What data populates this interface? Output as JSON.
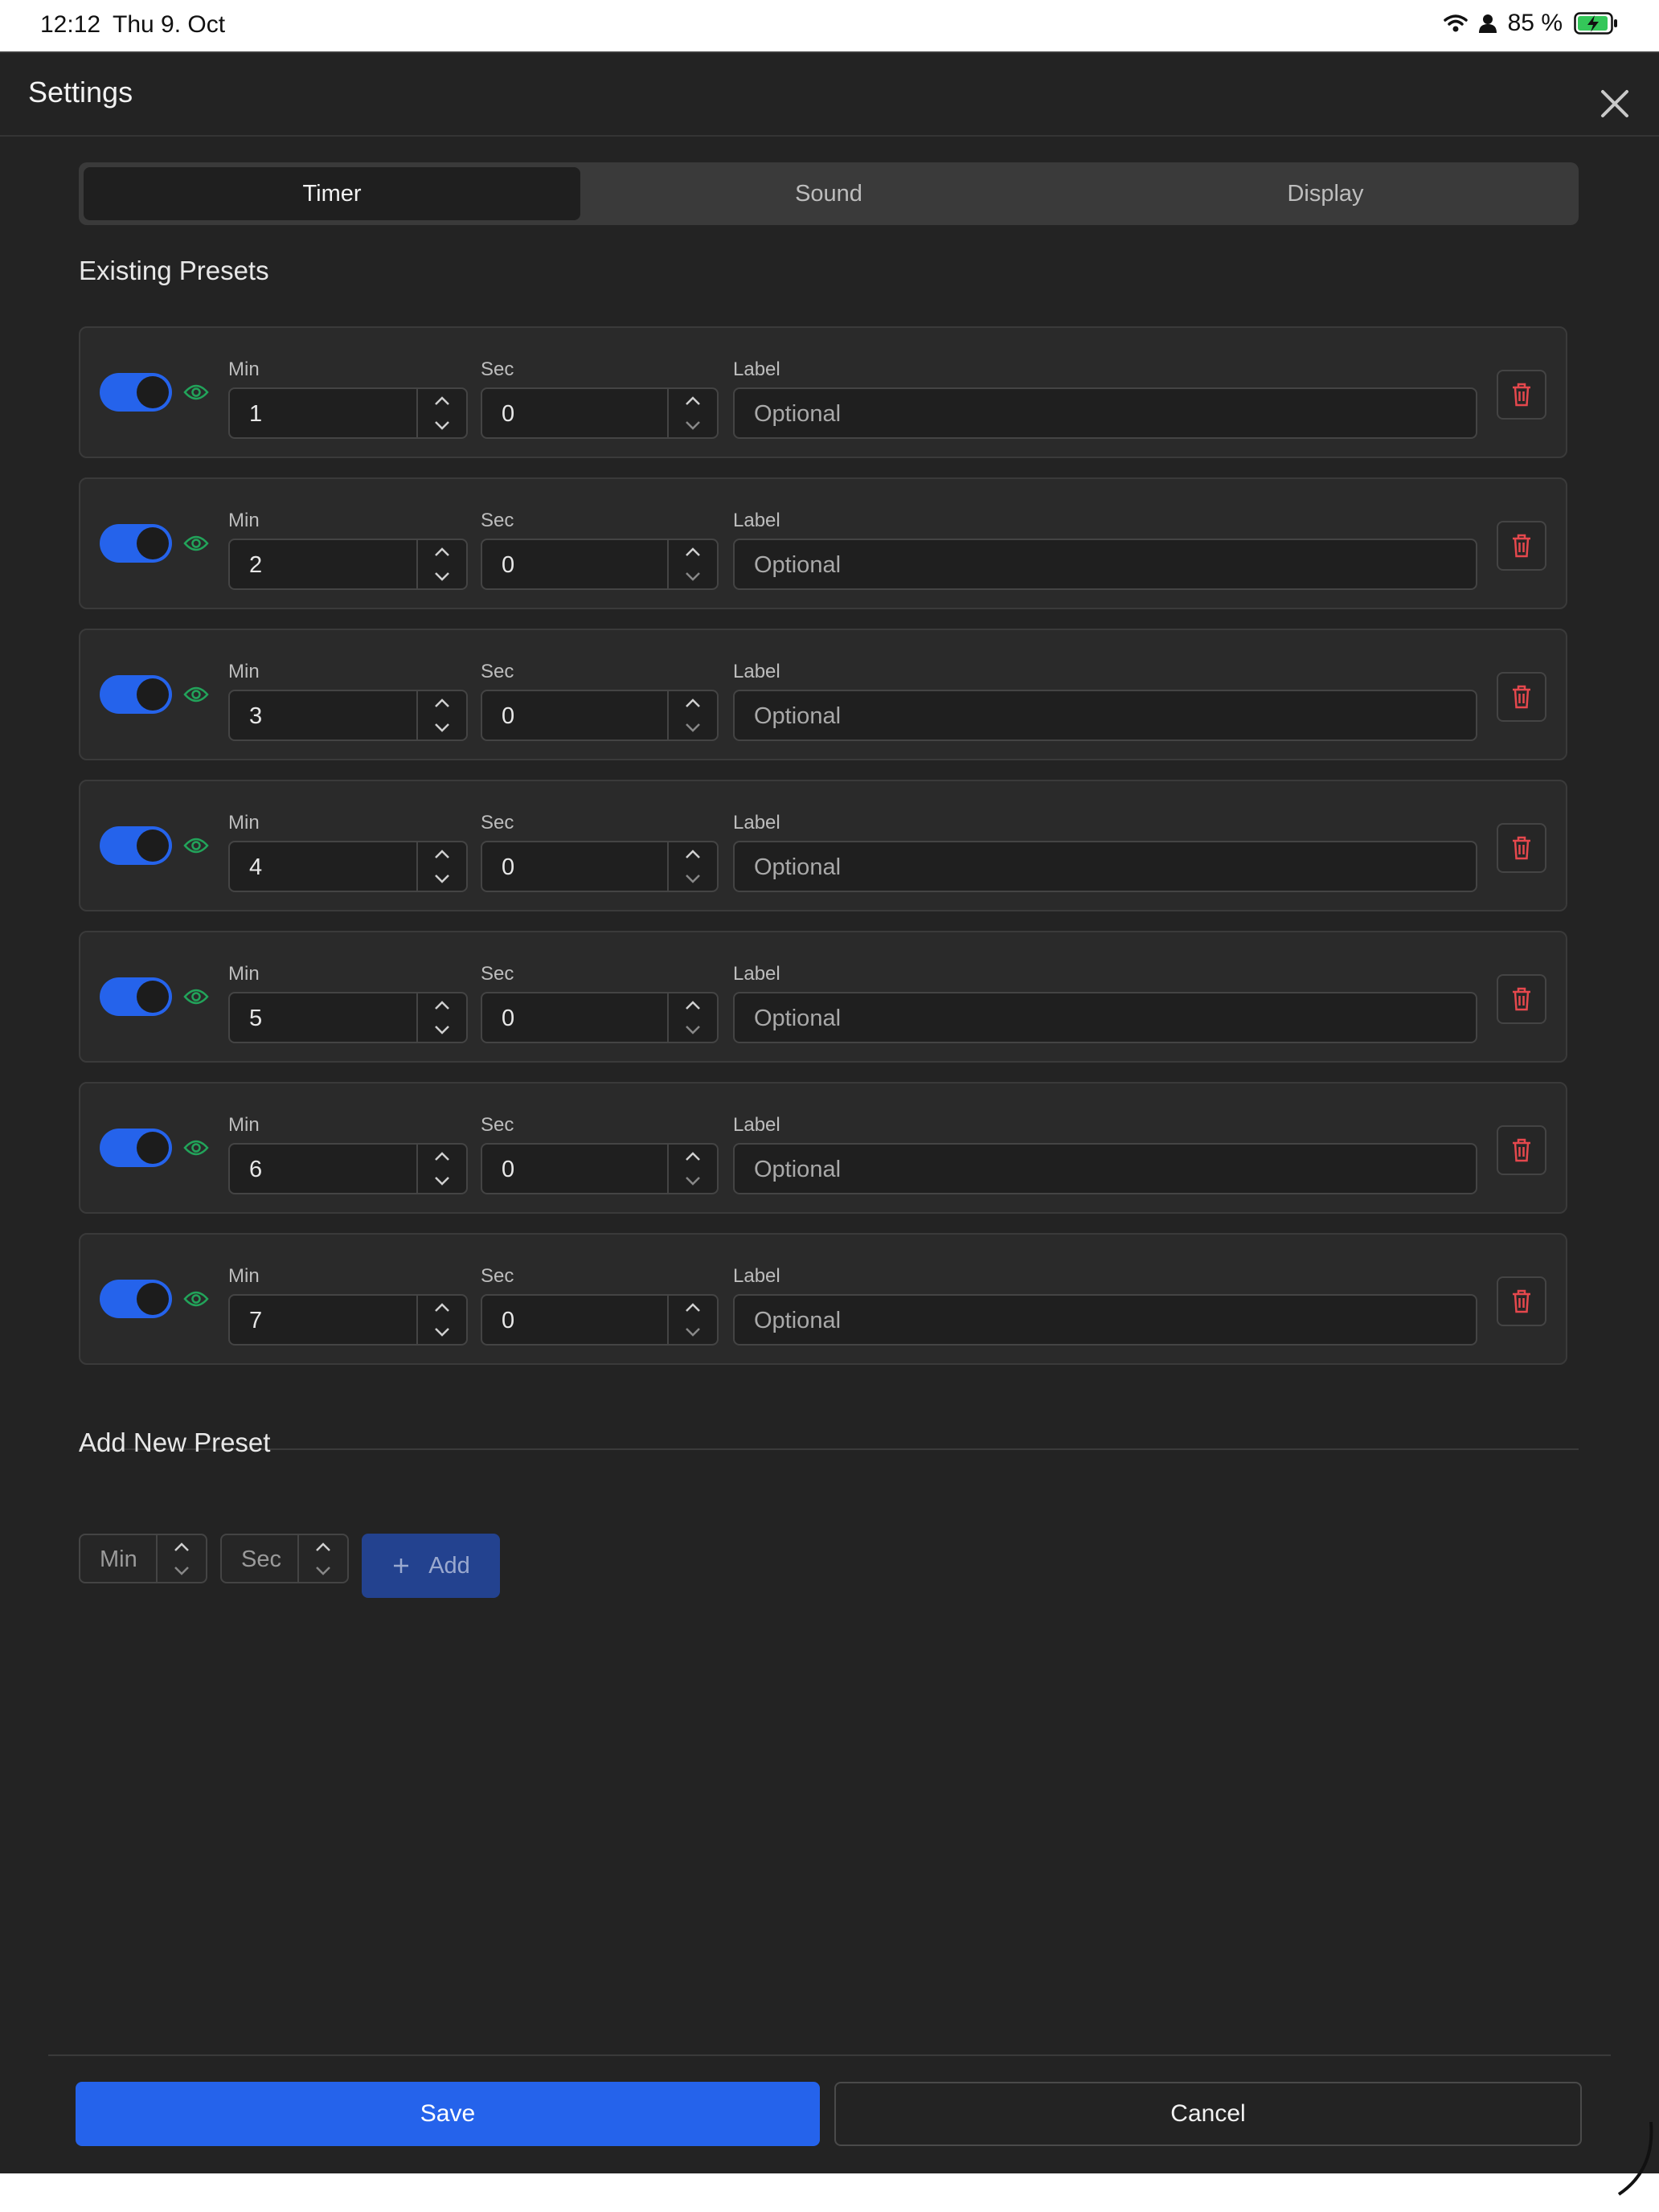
{
  "status_bar": {
    "time": "12:12",
    "date": "Thu 9. Oct",
    "battery_text": "85 %"
  },
  "sheet": {
    "title": "Settings"
  },
  "tabs": [
    {
      "label": "Timer",
      "active": true
    },
    {
      "label": "Sound",
      "active": false
    },
    {
      "label": "Display",
      "active": false
    }
  ],
  "existing": {
    "title": "Existing Presets",
    "min_label": "Min",
    "sec_label": "Sec",
    "label_label": "Label",
    "label_placeholder": "Optional",
    "presets": [
      {
        "enabled": true,
        "min": "1",
        "sec": "0"
      },
      {
        "enabled": true,
        "min": "2",
        "sec": "0"
      },
      {
        "enabled": true,
        "min": "3",
        "sec": "0"
      },
      {
        "enabled": true,
        "min": "4",
        "sec": "0"
      },
      {
        "enabled": true,
        "min": "5",
        "sec": "0"
      },
      {
        "enabled": true,
        "min": "6",
        "sec": "0"
      },
      {
        "enabled": true,
        "min": "7",
        "sec": "0"
      }
    ]
  },
  "add_new": {
    "title": "Add New Preset",
    "min_placeholder": "Min",
    "sec_placeholder": "Sec",
    "add_label": "Add"
  },
  "footer": {
    "save_label": "Save",
    "cancel_label": "Cancel"
  },
  "colors": {
    "accent": "#2563eb",
    "eye_green": "#22a35a",
    "trash_red": "#e5484d",
    "background": "#232323"
  },
  "icons": [
    "wifi-icon",
    "person-icon",
    "battery-charging-icon",
    "close-icon",
    "eye-icon",
    "trash-icon",
    "chevron-up-icon",
    "chevron-down-icon",
    "plus-icon"
  ]
}
